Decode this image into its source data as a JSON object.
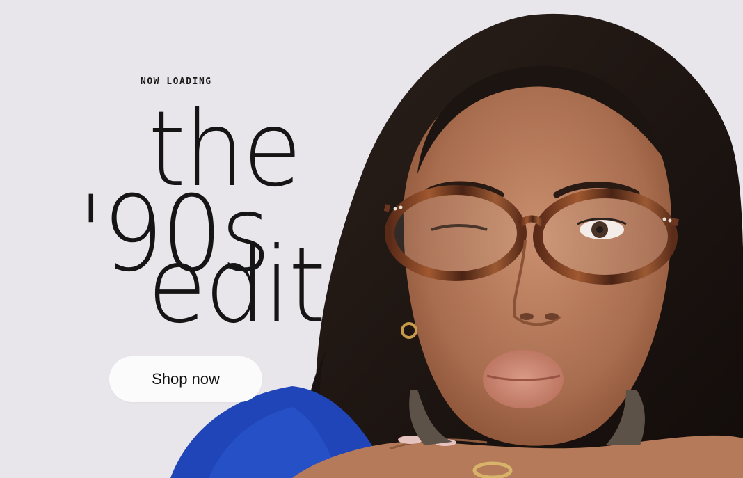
{
  "hero": {
    "eyebrow": "NOW LOADING",
    "headline": {
      "line1": "the",
      "line2": "'90s",
      "line3": "edit"
    },
    "cta_label": "Shop now",
    "image": {
      "subject": "person-in-round-tortoiseshell-glasses-winking"
    }
  },
  "colors": {
    "background": "#e8e6ea",
    "text": "#151515",
    "button_bg": "#fbfbfb",
    "frame_tortoise": "#7a3f24",
    "sweater": "#1f45b8"
  }
}
